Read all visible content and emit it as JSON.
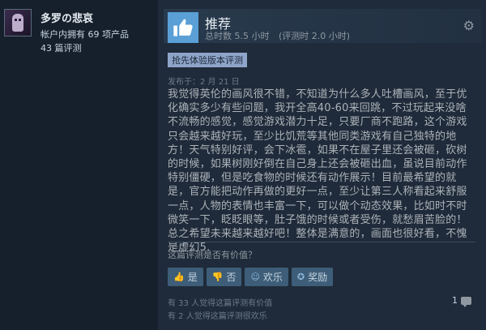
{
  "author": {
    "persona_name": "多罗の悲哀",
    "products_owned": "帐户内拥有 69 项产品",
    "reviews_count": "43 篇评测"
  },
  "review": {
    "recommendation": "推荐",
    "hours_total": "总时数 5.5 小时",
    "hours_at_review": "(评测时 2.0 小时)",
    "early_access_badge": "抢先体验版本评测",
    "posted": "发布于：2 月 21 日",
    "content": "我觉得英伦的画风很不错，不知道为什么多人吐槽画风，至于优化确实多少有些问题，我开全高40-60来回跳，不过玩起来没啥不流畅的感觉，感觉游戏潜力十足，只要厂商不跑路，这个游戏只会越来越好玩，至少比饥荒等其他同类游戏有自己独特的地方！天气特别好评，会下冰雹，如果不在屋子里还会被砸，砍树的时候，如果树刚好倒在自己身上还会被砸出血，虽说目前动作特别僵硬，但是吃食物的时候还有动作展示！目前最希望的就是，官方能把动作再做的更好一点，至少让第三人称看起来舒服一点，人物的表情也丰富一下，可以做个动态效果，比如时不时微笑一下，眨眨眼等，肚子饿的时候或者受伤，就愁眉苦脸的！总之希望未来越来越好吧！整体是满意的，画面也很好看，不愧是虚幻5."
  },
  "helpful": {
    "question": "这篇评测是否有价值？",
    "yes": "是",
    "no": "否",
    "funny": "欢乐",
    "award": "奖励",
    "helpful_count": "有 33 人觉得这篇评测有价值",
    "funny_count": "有 2 人觉得这篇评测很欢乐",
    "comments_count": "1"
  },
  "icons": {
    "thumbs_up": "thumbs-up-icon",
    "gear": "gear-icon",
    "comment": "comment-bubble-icon"
  },
  "colors": {
    "background": "#1b2838",
    "accent": "#5a9fd6",
    "badge": "#8ea4c9",
    "button": "#3d5d78"
  }
}
